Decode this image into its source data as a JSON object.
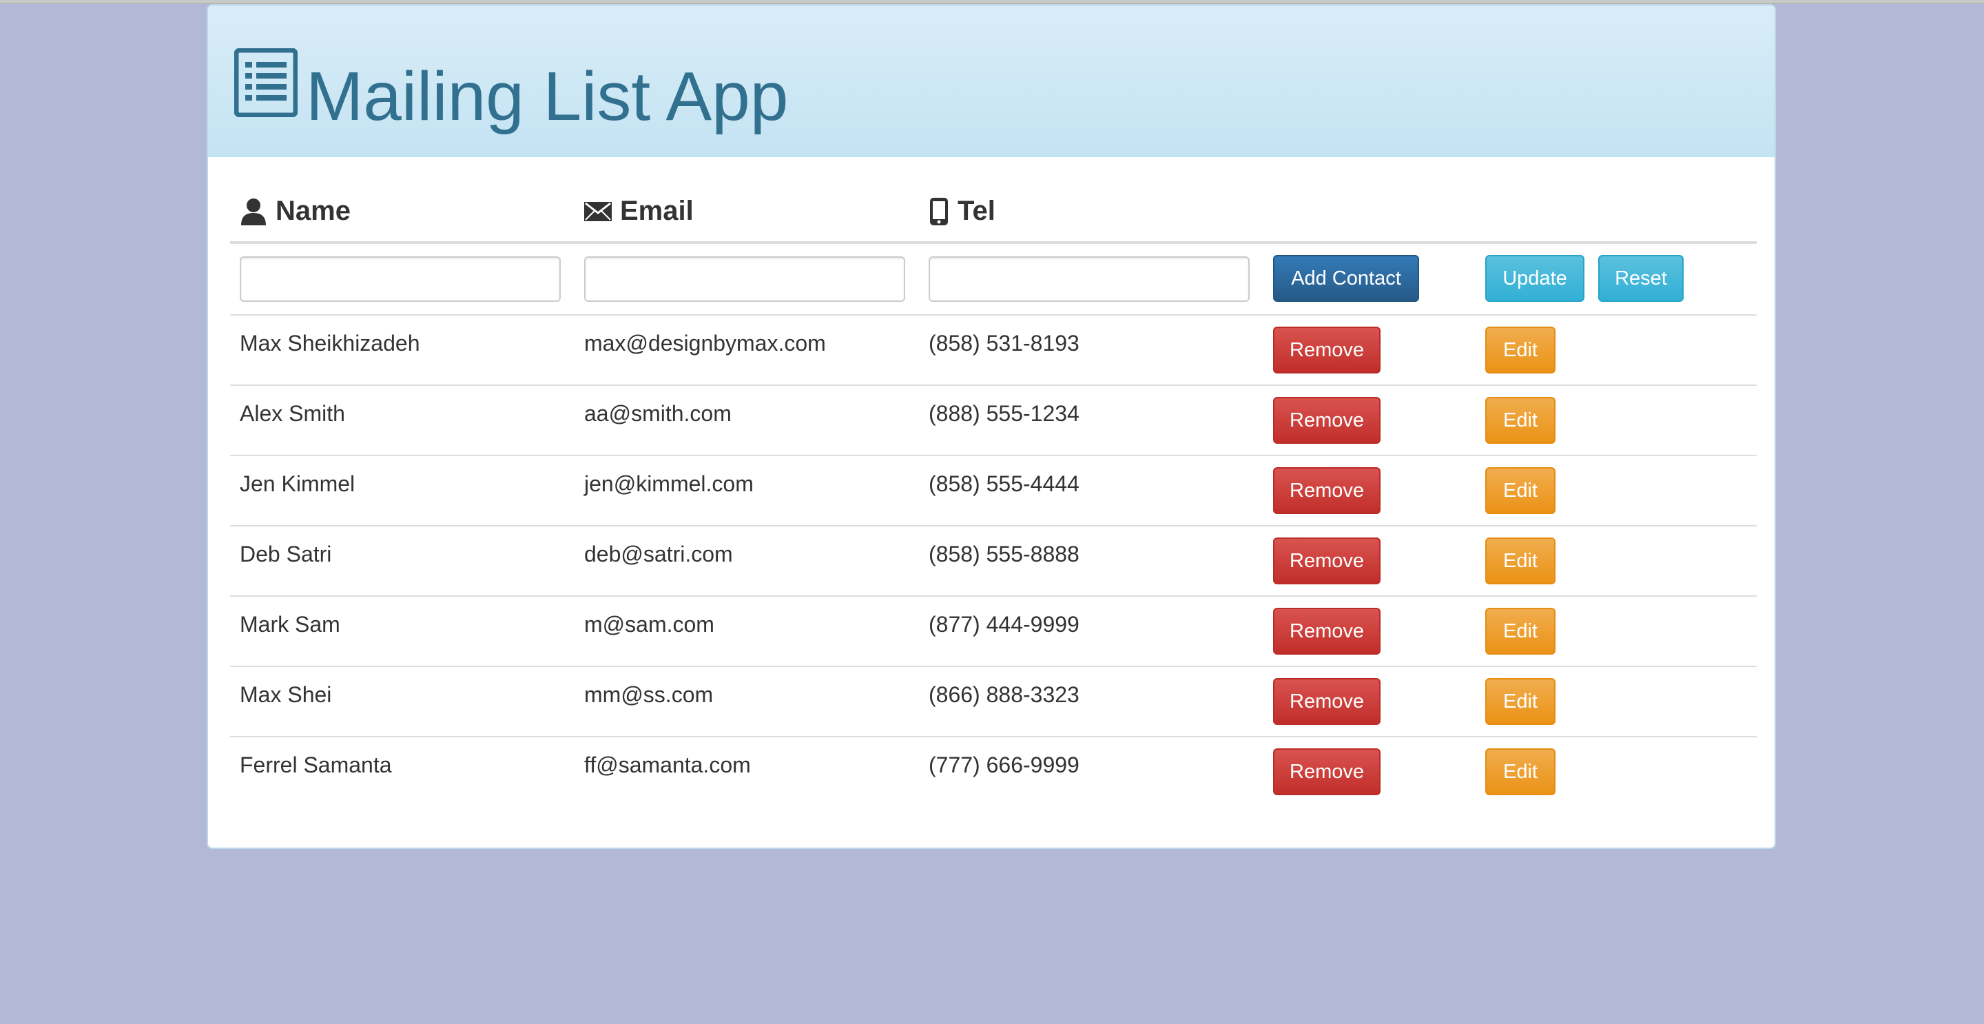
{
  "app": {
    "title": "Mailing List App",
    "icon": "list-alt-icon"
  },
  "columns": [
    {
      "label": "Name",
      "icon": "user-icon"
    },
    {
      "label": "Email",
      "icon": "envelope-icon"
    },
    {
      "label": "Tel",
      "icon": "phone-icon"
    }
  ],
  "form": {
    "name_value": "",
    "email_value": "",
    "tel_value": "",
    "add_label": "Add Contact",
    "update_label": "Update",
    "reset_label": "Reset"
  },
  "row_actions": {
    "remove_label": "Remove",
    "edit_label": "Edit"
  },
  "contacts": [
    {
      "name": "Max Sheikhizadeh",
      "email": "max@designbymax.com",
      "tel": "(858) 531-8193"
    },
    {
      "name": "Alex Smith",
      "email": "aa@smith.com",
      "tel": "(888) 555-1234"
    },
    {
      "name": "Jen Kimmel",
      "email": "jen@kimmel.com",
      "tel": "(858) 555-4444"
    },
    {
      "name": "Deb Satri",
      "email": "deb@satri.com",
      "tel": "(858) 555-8888"
    },
    {
      "name": "Mark Sam",
      "email": "m@sam.com",
      "tel": "(877) 444-9999"
    },
    {
      "name": "Max Shei",
      "email": "mm@ss.com",
      "tel": "(866) 888-3323"
    },
    {
      "name": "Ferrel Samanta",
      "email": "ff@samanta.com",
      "tel": "(777) 666-9999"
    }
  ],
  "colors": {
    "background": "#b4b8d8",
    "heading_bg": "#d9edf7",
    "title": "#31708f",
    "primary": "#337ab7",
    "info": "#5bc0de",
    "danger": "#d9534f",
    "warning": "#f0ad4e"
  }
}
